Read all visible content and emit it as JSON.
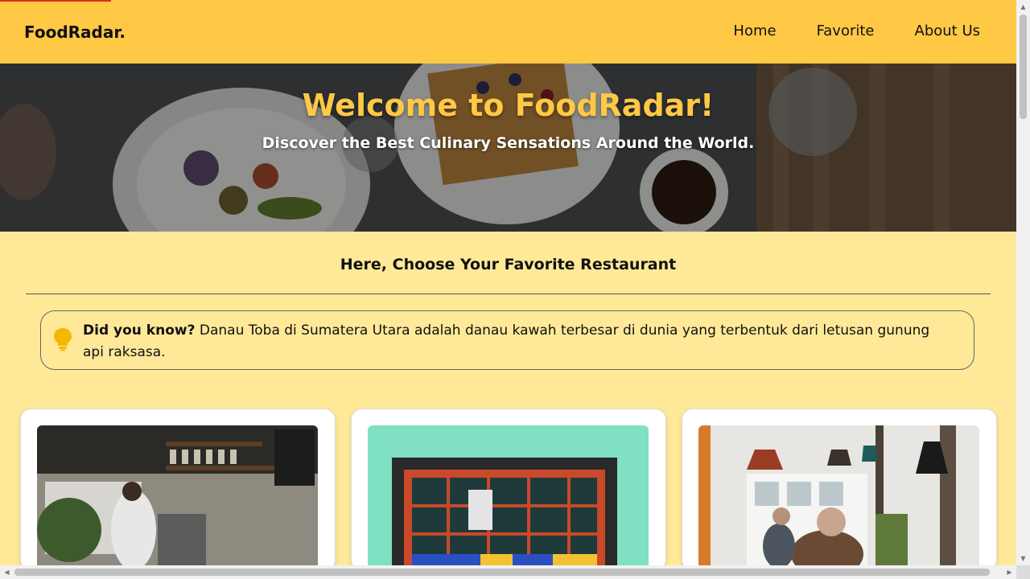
{
  "brand": "FoodRadar.",
  "nav": {
    "home": "Home",
    "favorite": "Favorite",
    "about": "About Us"
  },
  "hero": {
    "title": "Welcome to FoodRadar!",
    "subtitle": "Discover the Best Culinary Sensations Around the World."
  },
  "section_title": "Here, Choose Your Favorite Restaurant",
  "tip": {
    "icon": "lightbulb-icon",
    "label": "Did you know?",
    "text": "Danau Toba di Sumatera Utara adalah danau kawah terbesar di dunia yang terbentuk dari letusan gunung api raksasa."
  },
  "colors": {
    "header": "#FFC845",
    "background": "#FFE999",
    "accent": "#FFC845",
    "bulb": "#F5B800"
  }
}
